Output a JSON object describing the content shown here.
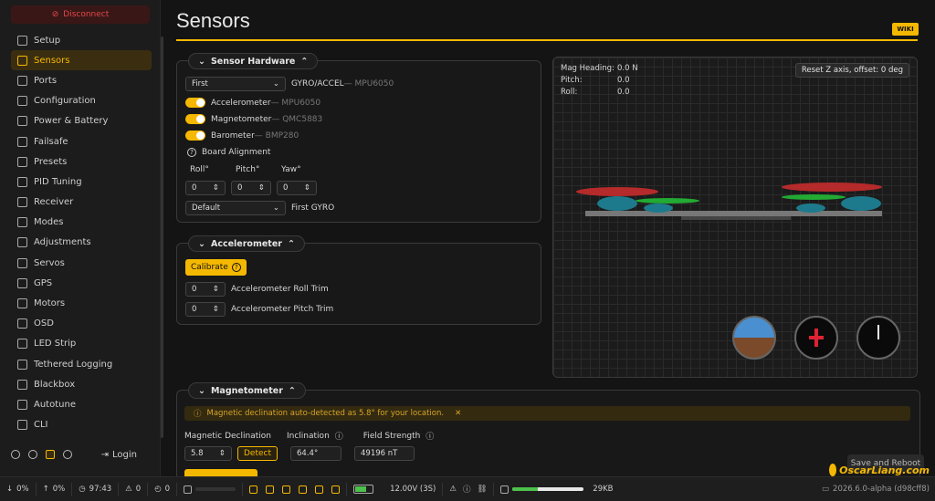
{
  "sidebar": {
    "disconnect": "Disconnect",
    "items": [
      {
        "label": "Setup",
        "icon": "sliders-icon"
      },
      {
        "label": "Sensors",
        "icon": "chip-icon",
        "active": true
      },
      {
        "label": "Ports",
        "icon": "plug-icon"
      },
      {
        "label": "Configuration",
        "icon": "gear-icon"
      },
      {
        "label": "Power & Battery",
        "icon": "battery-icon"
      },
      {
        "label": "Failsafe",
        "icon": "shield-icon"
      },
      {
        "label": "Presets",
        "icon": "magic-icon"
      },
      {
        "label": "PID Tuning",
        "icon": "gauge-icon"
      },
      {
        "label": "Receiver",
        "icon": "antenna-icon"
      },
      {
        "label": "Modes",
        "icon": "toggle-icon"
      },
      {
        "label": "Adjustments",
        "icon": "adjust-icon"
      },
      {
        "label": "Servos",
        "icon": "servo-icon"
      },
      {
        "label": "GPS",
        "icon": "gps-icon"
      },
      {
        "label": "Motors",
        "icon": "motor-icon"
      },
      {
        "label": "OSD",
        "icon": "monitor-icon"
      },
      {
        "label": "LED Strip",
        "icon": "bulb-icon"
      },
      {
        "label": "Tethered Logging",
        "icon": "log-icon"
      },
      {
        "label": "Blackbox",
        "icon": "box-icon"
      },
      {
        "label": "Autotune",
        "icon": "tune-icon"
      },
      {
        "label": "CLI",
        "icon": "terminal-icon"
      }
    ],
    "login": "Login"
  },
  "header": {
    "title": "Sensors",
    "wiki": "WIKI"
  },
  "hardware": {
    "title": "Sensor Hardware",
    "gyro_select": "First",
    "gyro_label": "GYRO/ACCEL",
    "gyro_chip": "— MPU6050",
    "accel_label": "Accelerometer",
    "accel_chip": "— MPU6050",
    "mag_label": "Magnetometer",
    "mag_chip": "— QMC5883",
    "baro_label": "Barometer",
    "baro_chip": "— BMP280",
    "board_alignment": "Board Alignment",
    "roll_label": "Roll°",
    "pitch_label": "Pitch°",
    "yaw_label": "Yaw°",
    "roll": "0",
    "pitch": "0",
    "yaw": "0",
    "gyro2_select": "Default",
    "gyro2_label": "First GYRO"
  },
  "accelerometer": {
    "title": "Accelerometer",
    "calibrate": "Calibrate",
    "roll_trim": "0",
    "roll_trim_label": "Accelerometer Roll Trim",
    "pitch_trim": "0",
    "pitch_trim_label": "Accelerometer Pitch Trim"
  },
  "view": {
    "mag_heading_label": "Mag Heading:",
    "mag_heading": "0.0 N",
    "pitch_label": "Pitch:",
    "pitch": "0.0",
    "roll_label": "Roll:",
    "roll": "0.0",
    "reset": "Reset Z axis, offset: 0 deg"
  },
  "magnetometer": {
    "title": "Magnetometer",
    "notice": "Magnetic declination auto-detected as 5.8° for your location.",
    "decl_label": "Magnetic Declination",
    "decl": "5.8",
    "detect": "Detect",
    "incl_label": "Inclination",
    "incl": "64.4°",
    "field_label": "Field Strength",
    "field": "49196 nT"
  },
  "save": "Save and Reboot",
  "status": {
    "down": "0%",
    "up": "0%",
    "time": "97:43",
    "warn": "0",
    "loop": "0",
    "voltage": "12.00V (3S)",
    "log": "29KB",
    "version": "2026.6.0-alpha (d98cff8)",
    "battery_fill": 0.6,
    "log_fill": 0.35
  },
  "watermark": "OscarLiang.com",
  "colors": {
    "accent": "#f5b800",
    "danger": "#e04848"
  }
}
